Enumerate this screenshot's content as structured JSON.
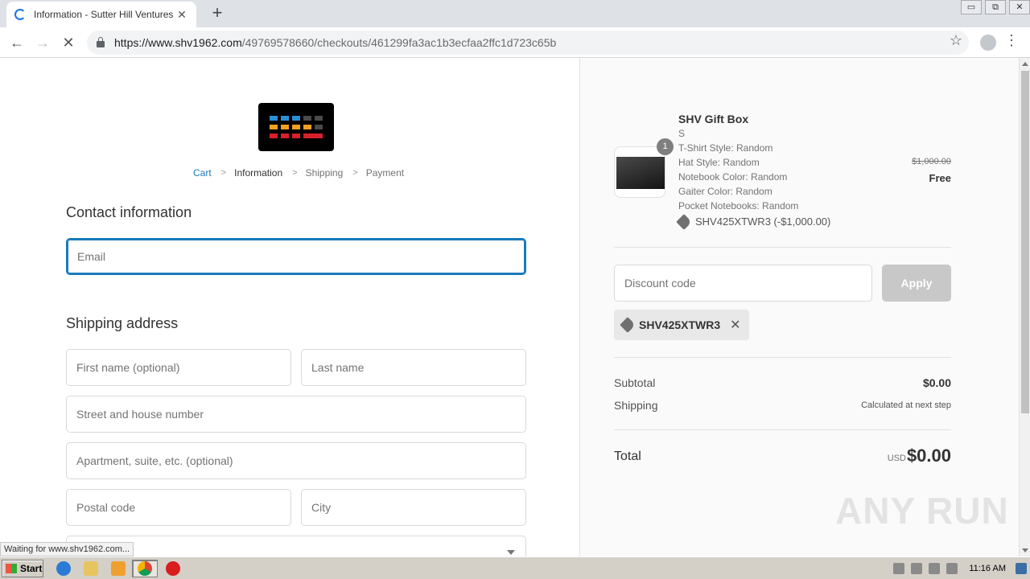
{
  "browser": {
    "tab_title": "Information - Sutter Hill Ventures - C",
    "tab_close": "✕",
    "new_tab": "+",
    "url_host": "https://www.shv1962.com",
    "url_path": "/49769578660/checkouts/461299fa3ac1b3ecfaa2ffc1d723c65b",
    "status_text": "Waiting for www.shv1962.com...",
    "window_controls": [
      "▭",
      "⧉",
      "✕"
    ],
    "nav_icons": {
      "back": "←",
      "forward": "→",
      "stop": "✕",
      "star": "☆",
      "menu": "⋮"
    }
  },
  "checkout": {
    "breadcrumbs": [
      {
        "label": "Cart",
        "state": "link"
      },
      {
        "label": "Information",
        "state": "current"
      },
      {
        "label": "Shipping",
        "state": "pending"
      },
      {
        "label": "Payment",
        "state": "pending"
      }
    ],
    "breadcrumb_sep": ">",
    "contact_heading": "Contact information",
    "email_placeholder": "Email",
    "shipping_heading": "Shipping address",
    "first_name_placeholder": "First name (optional)",
    "last_name_placeholder": "Last name",
    "street_placeholder": "Street and house number",
    "apartment_placeholder": "Apartment, suite, etc. (optional)",
    "postal_placeholder": "Postal code",
    "city_placeholder": "City"
  },
  "summary": {
    "product_name": "SHV Gift Box",
    "quantity": "1",
    "variants": [
      "S",
      "T-Shirt Style: Random",
      "Hat Style: Random",
      "Notebook Color: Random",
      "Gaiter Color: Random",
      "Pocket Notebooks: Random"
    ],
    "product_discount": "SHV425XTWR3 (-$1,000.00)",
    "original_price": "$1,000.00",
    "price": "Free",
    "discount_placeholder": "Discount code",
    "apply_label": "Apply",
    "applied_code": "SHV425XTWR3",
    "remove_code": "✕",
    "subtotal_label": "Subtotal",
    "subtotal_value": "$0.00",
    "shipping_label": "Shipping",
    "shipping_value": "Calculated at next step",
    "total_label": "Total",
    "total_currency": "USD",
    "total_value": "$0.00"
  },
  "watermark": "ANY RUN",
  "taskbar": {
    "start_label": "Start",
    "clock": "11:16 AM"
  },
  "colors": {
    "accent": "#197bbd",
    "logo_blue": "#2b8fd6",
    "logo_orange": "#f0a020",
    "logo_red": "#d6202a",
    "logo_gray": "#4a4a4a"
  }
}
